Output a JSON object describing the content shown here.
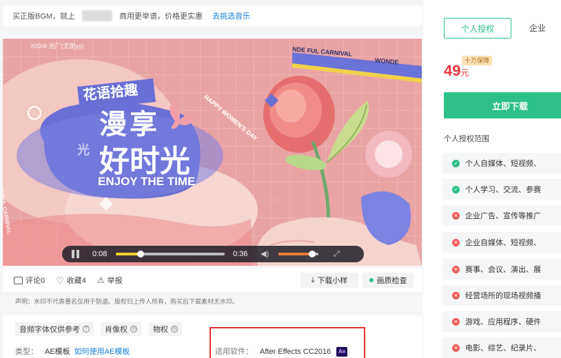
{
  "topbar": {
    "prefix": "买正版BGM，就上",
    "middle": "商用更举谱，价格更实惠",
    "link": "去挑选音乐"
  },
  "video": {
    "watermark": "XISHI·光厂(尤丽yy)",
    "title_line1": "花语拾趣",
    "title_line2": "漫享",
    "title_line3": "好时光",
    "subtitle": "ENJOY THE TIME",
    "carnival_1": "NDE FUL CARNIVAL",
    "carnival_2": "WONDE",
    "carnival_3": "FUL C",
    "happy": "HAPPY WOMEN'S DAY",
    "side": "# WONDERFUL CARNIVAL",
    "logo_text": "光",
    "current_time": "0:08",
    "duration": "0:36",
    "progress": 0.23,
    "volume": 0.8
  },
  "actions": {
    "comment": "评论0",
    "favorite": "收藏4",
    "report": "举报",
    "download_sample": "下载小样",
    "quality_check": "画质检查"
  },
  "notice": "声明：水印不代表署名仅用于防盗。版权归上传人所有，购买后下载素材无水印。",
  "tags": {
    "audio_font": "音频字体仅供参考",
    "portrait": "肖像权",
    "property": "物权"
  },
  "meta": {
    "type_label": "类型：",
    "type_value": "AE模板",
    "type_link": "如何使用AE模板",
    "software_label": "适用软件：",
    "software_value": "After Effects CC2016",
    "software_badge": "Ae"
  },
  "license": {
    "tab_personal": "个人授权",
    "tab_enterprise": "企业",
    "guarantee": "十万保障",
    "price": "49",
    "unit": "元",
    "download_button": "立即下载",
    "scope_title": "个人授权范围",
    "scope": [
      {
        "text": "个人自媒体、短视频、",
        "allowed": true
      },
      {
        "text": "个人学习、交流、参赛",
        "allowed": true
      },
      {
        "text": "企业广告、宣传等推广",
        "allowed": false
      },
      {
        "text": "企业自媒体、短视频、",
        "allowed": false
      },
      {
        "text": "赛事、会议、演出、展",
        "allowed": false
      },
      {
        "text": "经营场所的现场视频播",
        "allowed": false
      },
      {
        "text": "游戏、应用程序、硬件",
        "allowed": false
      },
      {
        "text": "电影、综艺、纪录片、",
        "allowed": false
      }
    ]
  },
  "colors": {
    "accent": "#2cc088",
    "price": "#e8373c",
    "link": "#1a7fd9",
    "highlight_box": "#e43131",
    "video_bg": "#e8a7a6",
    "purple": "#6a6fd6"
  }
}
